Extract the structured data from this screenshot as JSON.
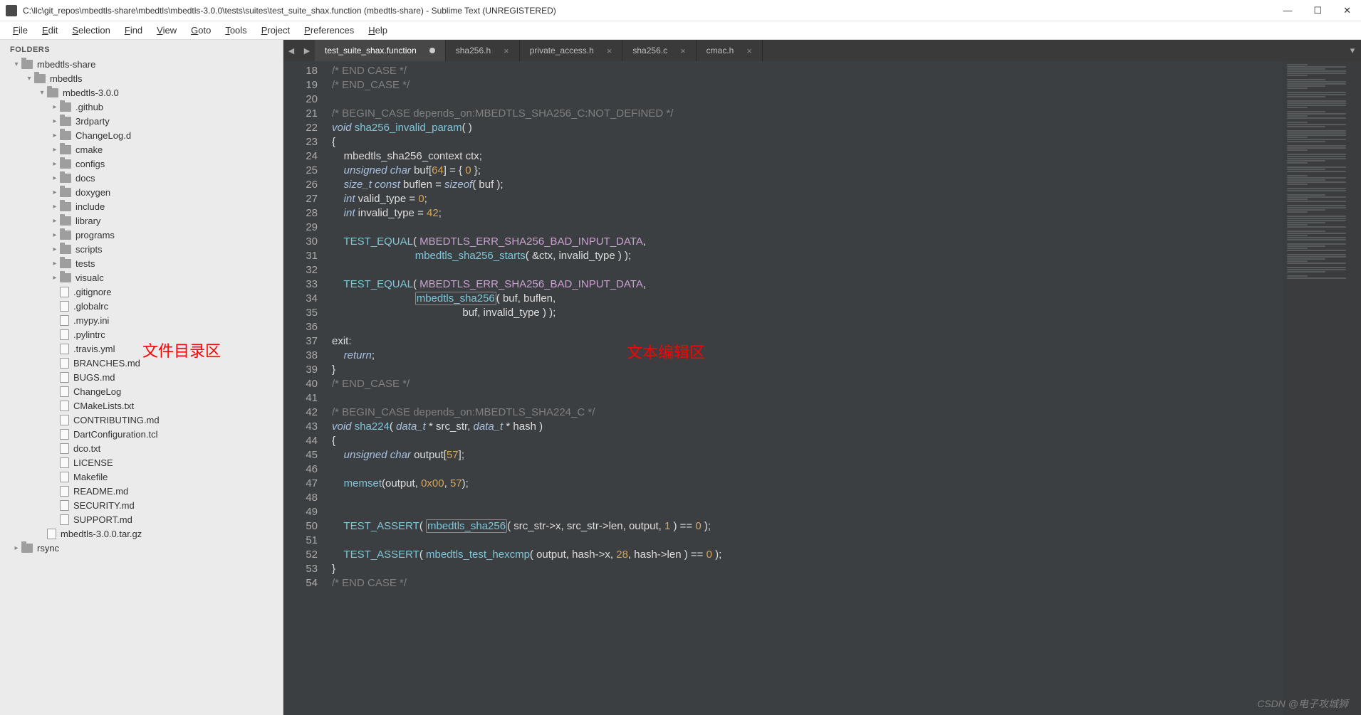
{
  "window": {
    "title": "C:\\llc\\git_repos\\mbedtls-share\\mbedtls\\mbedtls-3.0.0\\tests\\suites\\test_suite_shax.function (mbedtls-share) - Sublime Text (UNREGISTERED)",
    "min": "—",
    "max": "☐",
    "close": "✕"
  },
  "menu": [
    "File",
    "Edit",
    "Selection",
    "Find",
    "View",
    "Goto",
    "Tools",
    "Project",
    "Preferences",
    "Help"
  ],
  "sidebar": {
    "header": "FOLDERS",
    "tree": [
      {
        "d": 0,
        "a": "▾",
        "t": "folder",
        "l": "mbedtls-share"
      },
      {
        "d": 1,
        "a": "▾",
        "t": "folder",
        "l": "mbedtls"
      },
      {
        "d": 2,
        "a": "▾",
        "t": "folder",
        "l": "mbedtls-3.0.0"
      },
      {
        "d": 3,
        "a": "▸",
        "t": "folder",
        "l": ".github"
      },
      {
        "d": 3,
        "a": "▸",
        "t": "folder",
        "l": "3rdparty"
      },
      {
        "d": 3,
        "a": "▸",
        "t": "folder",
        "l": "ChangeLog.d"
      },
      {
        "d": 3,
        "a": "▸",
        "t": "folder",
        "l": "cmake"
      },
      {
        "d": 3,
        "a": "▸",
        "t": "folder",
        "l": "configs"
      },
      {
        "d": 3,
        "a": "▸",
        "t": "folder",
        "l": "docs"
      },
      {
        "d": 3,
        "a": "▸",
        "t": "folder",
        "l": "doxygen"
      },
      {
        "d": 3,
        "a": "▸",
        "t": "folder",
        "l": "include"
      },
      {
        "d": 3,
        "a": "▸",
        "t": "folder",
        "l": "library"
      },
      {
        "d": 3,
        "a": "▸",
        "t": "folder",
        "l": "programs"
      },
      {
        "d": 3,
        "a": "▸",
        "t": "folder",
        "l": "scripts"
      },
      {
        "d": 3,
        "a": "▸",
        "t": "folder",
        "l": "tests"
      },
      {
        "d": 3,
        "a": "▸",
        "t": "folder",
        "l": "visualc"
      },
      {
        "d": 3,
        "a": "",
        "t": "file",
        "l": ".gitignore"
      },
      {
        "d": 3,
        "a": "",
        "t": "file",
        "l": ".globalrc"
      },
      {
        "d": 3,
        "a": "",
        "t": "file",
        "l": ".mypy.ini"
      },
      {
        "d": 3,
        "a": "",
        "t": "file",
        "l": ".pylintrc"
      },
      {
        "d": 3,
        "a": "",
        "t": "file",
        "l": ".travis.yml"
      },
      {
        "d": 3,
        "a": "",
        "t": "file",
        "l": "BRANCHES.md"
      },
      {
        "d": 3,
        "a": "",
        "t": "file",
        "l": "BUGS.md"
      },
      {
        "d": 3,
        "a": "",
        "t": "file",
        "l": "ChangeLog"
      },
      {
        "d": 3,
        "a": "",
        "t": "file",
        "l": "CMakeLists.txt"
      },
      {
        "d": 3,
        "a": "",
        "t": "file",
        "l": "CONTRIBUTING.md"
      },
      {
        "d": 3,
        "a": "",
        "t": "file",
        "l": "DartConfiguration.tcl"
      },
      {
        "d": 3,
        "a": "",
        "t": "file",
        "l": "dco.txt"
      },
      {
        "d": 3,
        "a": "",
        "t": "file",
        "l": "LICENSE"
      },
      {
        "d": 3,
        "a": "",
        "t": "file",
        "l": "Makefile"
      },
      {
        "d": 3,
        "a": "",
        "t": "file",
        "l": "README.md"
      },
      {
        "d": 3,
        "a": "",
        "t": "file",
        "l": "SECURITY.md"
      },
      {
        "d": 3,
        "a": "",
        "t": "file",
        "l": "SUPPORT.md"
      },
      {
        "d": 2,
        "a": "",
        "t": "file",
        "l": "mbedtls-3.0.0.tar.gz"
      },
      {
        "d": 0,
        "a": "▸",
        "t": "folder",
        "l": "rsync"
      }
    ],
    "annotation": "文件目录区"
  },
  "tabs": {
    "nav_left": "◀",
    "nav_right": "▶",
    "menu": "▾",
    "items": [
      {
        "label": "test_suite_shax.function",
        "active": true,
        "dirty": true
      },
      {
        "label": "sha256.h",
        "active": false,
        "dirty": false
      },
      {
        "label": "private_access.h",
        "active": false,
        "dirty": false
      },
      {
        "label": "sha256.c",
        "active": false,
        "dirty": false
      },
      {
        "label": "cmac.h",
        "active": false,
        "dirty": false
      }
    ]
  },
  "editor_annotation": "文本编辑区",
  "code": {
    "first_line": 18,
    "lines": [
      {
        "html": "<span class='c-comment'>/* END CASE */</span>"
      },
      {
        "html": "<span class='c-comment'>/* END_CASE */</span>"
      },
      {
        "html": ""
      },
      {
        "html": "<span class='c-comment'>/* BEGIN_CASE depends_on:MBEDTLS_SHA256_C:NOT_DEFINED */</span>"
      },
      {
        "html": "<span class='c-type'>void</span> <span class='c-func'>sha256_invalid_param</span>( )"
      },
      {
        "html": "{"
      },
      {
        "html": "    mbedtls_sha256_context ctx;"
      },
      {
        "html": "    <span class='c-type'>unsigned</span> <span class='c-type'>char</span> buf[<span class='c-num'>64</span>] = { <span class='c-num'>0</span> };"
      },
      {
        "html": "    <span class='c-type'>size_t</span> <span class='c-keyword'>const</span> buflen = <span class='c-keyword'>sizeof</span>( buf );"
      },
      {
        "html": "    <span class='c-type'>int</span> valid_type = <span class='c-num'>0</span>;"
      },
      {
        "html": "    <span class='c-type'>int</span> invalid_type = <span class='c-num'>42</span>;"
      },
      {
        "html": ""
      },
      {
        "html": "    <span class='c-func'>TEST_EQUAL</span>( <span class='c-caps'>MBEDTLS_ERR_SHA256_BAD_INPUT_DATA</span>,"
      },
      {
        "html": "                            <span class='c-func'>mbedtls_sha256_starts</span>( &amp;ctx, invalid_type ) );"
      },
      {
        "html": ""
      },
      {
        "html": "    <span class='c-func'>TEST_EQUAL</span>( <span class='c-caps'>MBEDTLS_ERR_SHA256_BAD_INPUT_DATA</span>,"
      },
      {
        "html": "                            <span class='c-func boxed'>mbedtls_sha256</span>( buf, buflen,"
      },
      {
        "html": "                                            buf, invalid_type ) );"
      },
      {
        "html": ""
      },
      {
        "html": "exit:"
      },
      {
        "html": "    <span class='c-keyword'>return</span>;"
      },
      {
        "html": "}"
      },
      {
        "html": "<span class='c-comment'>/* END_CASE */</span>"
      },
      {
        "html": ""
      },
      {
        "html": "<span class='c-comment'>/* BEGIN_CASE depends_on:MBEDTLS_SHA224_C */</span>"
      },
      {
        "html": "<span class='c-type'>void</span> <span class='c-func'>sha224</span>( <span class='c-type'>data_t</span> * src_str, <span class='c-type'>data_t</span> * hash )"
      },
      {
        "html": "{"
      },
      {
        "html": "    <span class='c-type'>unsigned</span> <span class='c-type'>char</span> output[<span class='c-num'>57</span>];"
      },
      {
        "html": ""
      },
      {
        "html": "    <span class='c-func'>memset</span>(output, <span class='c-num'>0x00</span>, <span class='c-num'>57</span>);"
      },
      {
        "html": ""
      },
      {
        "html": ""
      },
      {
        "html": "    <span class='c-func'>TEST_ASSERT</span>( <span class='c-func boxed'>mbedtls_sha256</span>( src_str-&gt;x, src_str-&gt;len, output, <span class='c-num'>1</span> ) == <span class='c-num'>0</span> );"
      },
      {
        "html": ""
      },
      {
        "html": "    <span class='c-func'>TEST_ASSERT</span>( <span class='c-func'>mbedtls_test_hexcmp</span>( output, hash-&gt;x, <span class='c-num'>28</span>, hash-&gt;len ) == <span class='c-num'>0</span> );"
      },
      {
        "html": "}"
      },
      {
        "html": "<span class='c-comment'>/* END CASE */</span>"
      }
    ]
  },
  "watermark": "CSDN @电子攻城狮"
}
